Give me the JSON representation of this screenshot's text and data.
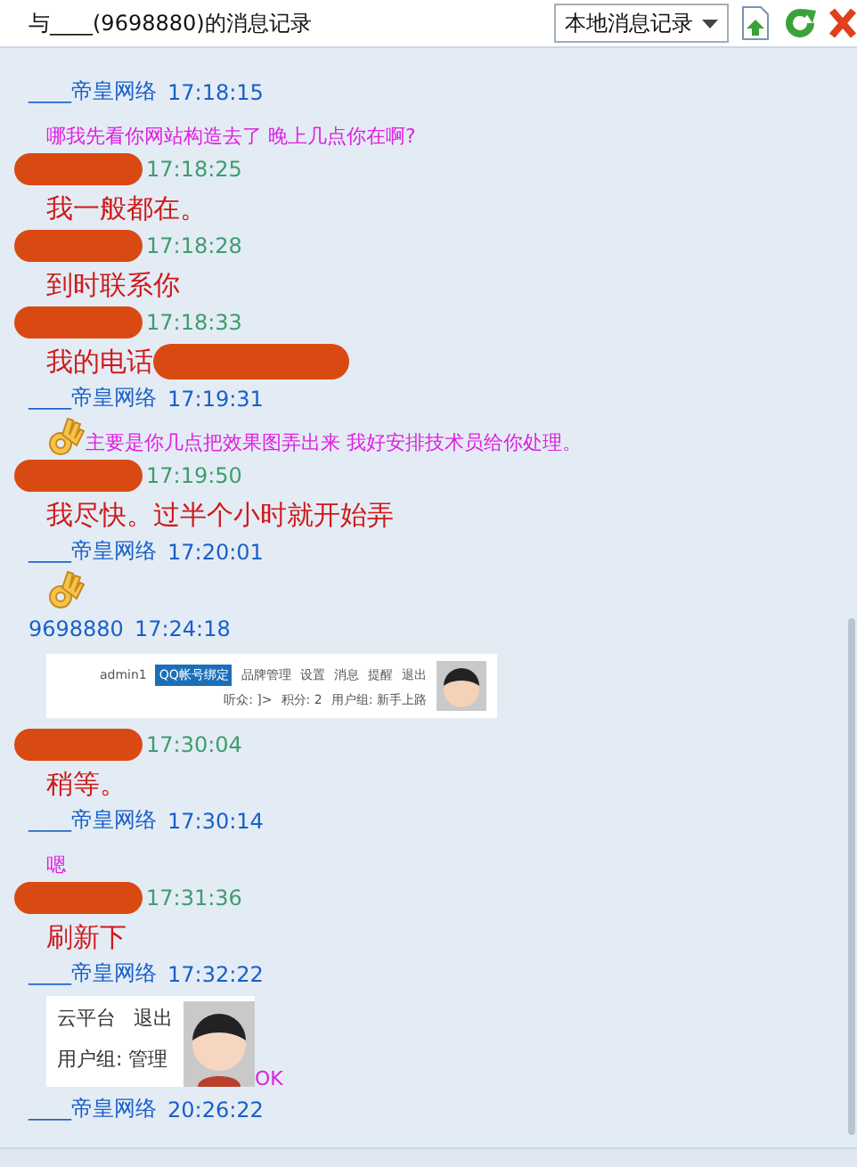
{
  "window": {
    "title": "与____(9698880)的消息记录"
  },
  "toolbar": {
    "source_select": "本地消息记录"
  },
  "messages": [
    {
      "kind": "them",
      "name": "____帝皇网络",
      "time": "17:18:15",
      "parts": [
        {
          "kind": "text",
          "text": "哪我先看你网站构造去了 晚上几点你在啊?"
        }
      ]
    },
    {
      "kind": "me",
      "time": "17:18:25",
      "parts": [
        {
          "kind": "text",
          "text": "我一般都在。"
        }
      ]
    },
    {
      "kind": "me",
      "time": "17:18:28",
      "parts": [
        {
          "kind": "text",
          "text": "到时联系你"
        }
      ]
    },
    {
      "kind": "me",
      "time": "17:18:33",
      "parts": [
        {
          "kind": "text",
          "text": "我的电话"
        },
        {
          "kind": "redacted"
        }
      ]
    },
    {
      "kind": "them",
      "name": "____帝皇网络",
      "time": "17:19:31",
      "parts": [
        {
          "kind": "emoji"
        },
        {
          "kind": "text",
          "text": "主要是你几点把效果图弄出来 我好安排技术员给你处理。"
        }
      ]
    },
    {
      "kind": "me",
      "time": "17:19:50",
      "parts": [
        {
          "kind": "text",
          "text": "我尽快。过半个小时就开始弄"
        }
      ]
    },
    {
      "kind": "them",
      "name": "____帝皇网络",
      "time": "17:20:01",
      "parts": [
        {
          "kind": "emoji"
        }
      ]
    },
    {
      "kind": "them",
      "name": "9698880",
      "time": "17:24:18",
      "parts": [
        {
          "kind": "toolbar_shot",
          "user": "admin1",
          "bind": "QQ帐号绑定",
          "links": [
            "品牌管理",
            "设置",
            "消息",
            "提醒",
            "退出"
          ],
          "stats": [
            "听众: ]>",
            "积分: 2",
            "用户组: 新手上路"
          ]
        }
      ]
    },
    {
      "kind": "me",
      "time": "17:30:04",
      "parts": [
        {
          "kind": "text",
          "text": "稍等。"
        }
      ]
    },
    {
      "kind": "them",
      "name": "____帝皇网络",
      "time": "17:30:14",
      "parts": [
        {
          "kind": "text",
          "text": "嗯"
        }
      ]
    },
    {
      "kind": "me",
      "time": "17:31:36",
      "parts": [
        {
          "kind": "text",
          "text": "刷新下"
        }
      ]
    },
    {
      "kind": "them",
      "name": "____帝皇网络",
      "time": "17:32:22",
      "parts": [
        {
          "kind": "panel_shot",
          "links": [
            "云平台",
            "退出"
          ],
          "group": "用户组: 管理"
        },
        {
          "kind": "text",
          "text": "OK"
        }
      ]
    },
    {
      "kind": "them",
      "name": "____帝皇网络",
      "time": "20:26:22"
    }
  ]
}
